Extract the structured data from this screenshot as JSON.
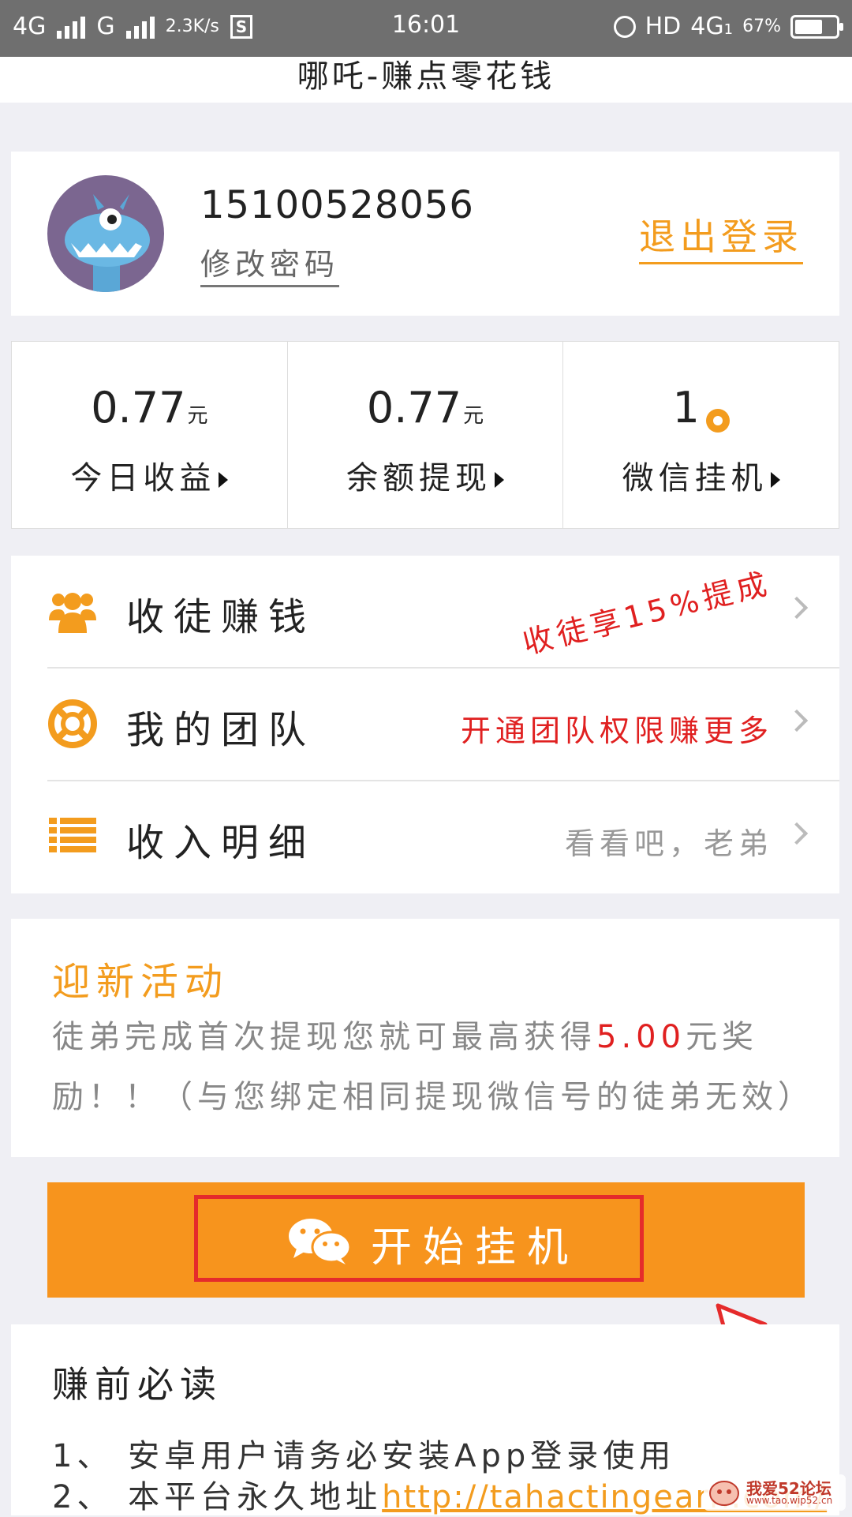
{
  "status_bar": {
    "network1": "4G",
    "network2": "G",
    "speed": "2.3K/s",
    "s_badge": "S",
    "time": "16:01",
    "hd": "HD",
    "network3": "4G",
    "network3_sub": "1",
    "battery": "67%",
    "battery_level": 0.67
  },
  "title": "哪吒-赚点零花钱",
  "profile": {
    "phone": "15100528056",
    "change_password": "修改密码",
    "logout": "退出登录"
  },
  "stats": [
    {
      "value": "0.77",
      "unit": "元",
      "label": "今日收益"
    },
    {
      "value": "0.77",
      "unit": "元",
      "label": "余额提现"
    },
    {
      "value": "1",
      "unit": "",
      "label": "微信挂机"
    }
  ],
  "menu": {
    "items": [
      {
        "label": "收徒赚钱",
        "hint": "收徒享15%提成",
        "hint_color": "#e02020",
        "icon": "users-icon"
      },
      {
        "label": "我的团队",
        "hint": "开通团队权限赚更多",
        "hint_color": "#e02020",
        "icon": "lifebuoy-icon"
      },
      {
        "label": "收入明细",
        "hint": "看看吧，老弟",
        "hint_color": "#999999",
        "icon": "list-icon"
      }
    ]
  },
  "promo": {
    "title": "迎新活动",
    "text_before": "徒弟完成首次提现您就可最高获得",
    "amount": "5.00",
    "text_after": "元奖励！！（与您绑定相同提现微信号的徒弟无效）"
  },
  "start_button": {
    "label": "开始挂机",
    "icon": "wechat-icon"
  },
  "notice": {
    "title": "赚前必读",
    "line1": "1、 安卓用户请务必安装App登录使用",
    "line2_prefix": "2、 本平台永久地址",
    "line2_link": "http://tahactingearn.com/"
  },
  "watermark": {
    "line1": "我爱52论坛",
    "line2": "www.tao.wip52.cn"
  },
  "colors": {
    "accent": "#f39c1e",
    "button": "#f7941d",
    "red": "#e02020"
  }
}
